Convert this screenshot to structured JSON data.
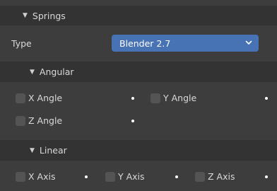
{
  "springs_panel": {
    "title": "Springs",
    "type_label": "Type",
    "type_value": "Blender 2.7",
    "dropdown_color": "#4772b3",
    "angular": {
      "title": "Angular",
      "x_angle": {
        "label": "X Angle",
        "checked": false
      },
      "y_angle": {
        "label": "Y Angle",
        "checked": false
      },
      "z_angle": {
        "label": "Z Angle",
        "checked": false
      }
    },
    "linear": {
      "title": "Linear",
      "x_axis": {
        "label": "X Axis",
        "checked": false
      },
      "y_axis": {
        "label": "Y Axis",
        "checked": false
      },
      "z_axis": {
        "label": "Z Axis",
        "checked": false
      }
    }
  }
}
